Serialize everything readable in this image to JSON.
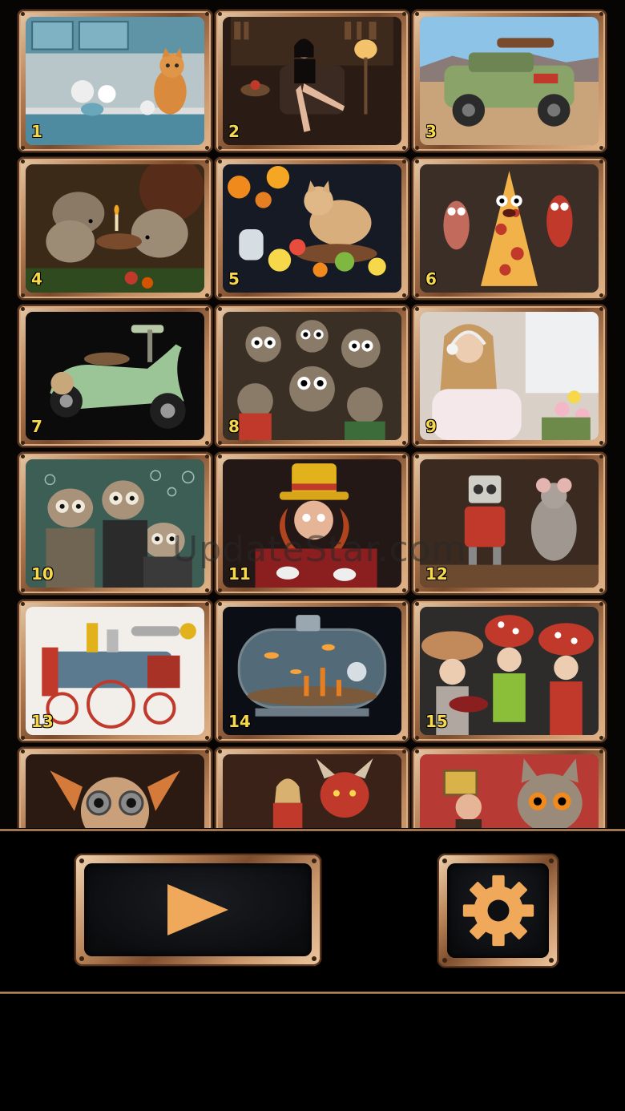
{
  "levels": [
    {
      "number": "1",
      "subject": "cat in blue kitchen"
    },
    {
      "number": "2",
      "subject": "woman reading in library"
    },
    {
      "number": "3",
      "subject": "rusty desert truck"
    },
    {
      "number": "4",
      "subject": "hedgehogs with candle"
    },
    {
      "number": "5",
      "subject": "cat with fruit still life"
    },
    {
      "number": "6",
      "subject": "pizza monsters"
    },
    {
      "number": "7",
      "subject": "steampunk green scooter"
    },
    {
      "number": "8",
      "subject": "crowd of googly-eyed creatures"
    },
    {
      "number": "9",
      "subject": "girl with headphones and flowers"
    },
    {
      "number": "10",
      "subject": "goggle-eyed aliens"
    },
    {
      "number": "11",
      "subject": "mad hatter tea party"
    },
    {
      "number": "12",
      "subject": "robot and rat"
    },
    {
      "number": "13",
      "subject": "red steam locomotive"
    },
    {
      "number": "14",
      "subject": "aquarium capsule"
    },
    {
      "number": "15",
      "subject": "mushroom children"
    },
    {
      "number": "",
      "subject": "goggled cat"
    },
    {
      "number": "",
      "subject": "woman with red devil"
    },
    {
      "number": "",
      "subject": "owl and man portrait"
    }
  ],
  "watermark": "UpdateStar.com",
  "controls": {
    "play_icon": "play-icon",
    "settings_icon": "gear-icon",
    "accent_color": "#f0a85a"
  },
  "colors": {
    "frame_light": "#e7c9a7",
    "frame_dark": "#7a4a2c",
    "number_color": "#f7d84a"
  }
}
